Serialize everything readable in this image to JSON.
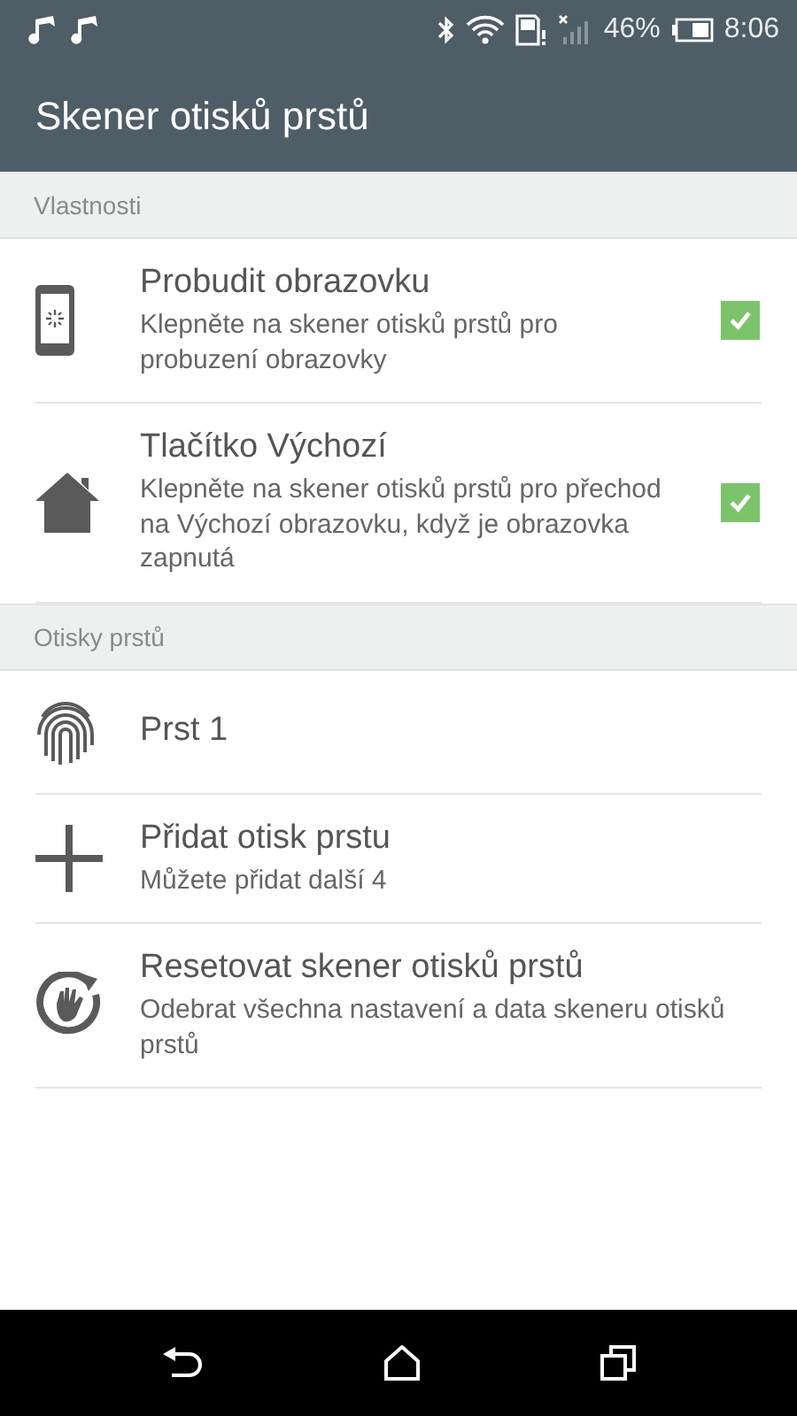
{
  "status_bar": {
    "battery": "46%",
    "time": "8:06"
  },
  "title": "Skener otisků prstů",
  "sections": [
    {
      "header": "Vlastnosti",
      "items": [
        {
          "kind": "checkbox",
          "title": "Probudit obrazovku",
          "subtitle": "Klepněte na skener otisků prstů pro probuzení obrazovky",
          "checked": true
        },
        {
          "kind": "checkbox",
          "title": "Tlačítko Výchozí",
          "subtitle": "Klepněte na skener otisků prstů pro přechod na Výchozí obrazovku, když je obrazovka zapnutá",
          "checked": true
        }
      ]
    },
    {
      "header": "Otisky prstů",
      "items": [
        {
          "kind": "plain",
          "title": "Prst 1"
        },
        {
          "kind": "plain",
          "title": "Přidat otisk prstu",
          "subtitle": "Můžete přidat další 4"
        },
        {
          "kind": "plain",
          "title": "Resetovat skener otisků prstů",
          "subtitle": "Odebrat všechna nastavení a data skeneru otisků prstů"
        }
      ]
    }
  ]
}
